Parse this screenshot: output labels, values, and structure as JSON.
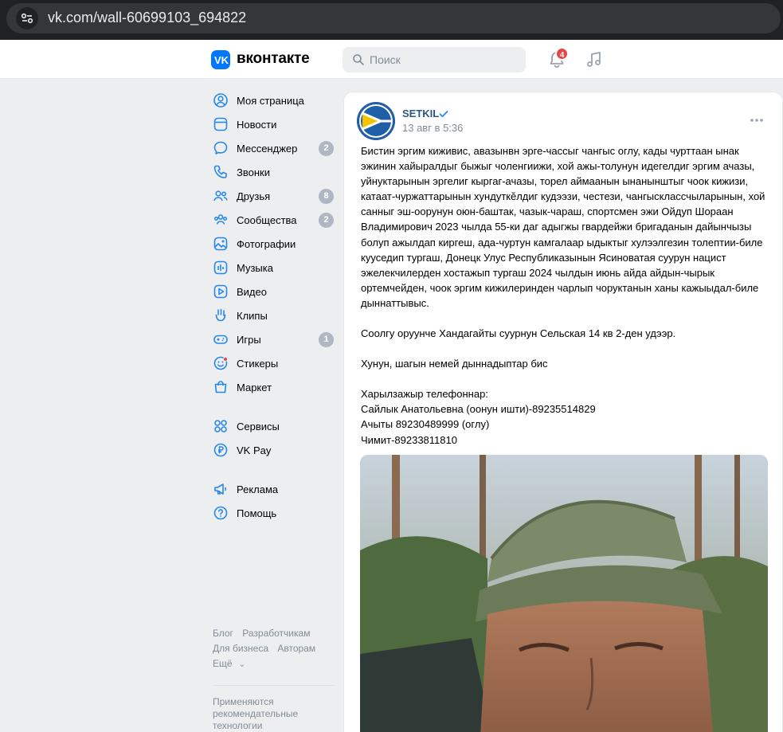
{
  "browser": {
    "url": "vk.com/wall-60699103_694822",
    "icon": "tune-icon"
  },
  "header": {
    "logo_text": "вконтакте",
    "search_placeholder": "Поиск",
    "notifications_count": "4",
    "icons": [
      "vk-logo-icon",
      "search-icon",
      "bell-icon",
      "music-icon"
    ]
  },
  "sidebar": {
    "items": [
      {
        "label": "Моя страница",
        "icon": "user-circle-icon"
      },
      {
        "label": "Новости",
        "icon": "newspaper-icon"
      },
      {
        "label": "Мессенджер",
        "icon": "chat-bubble-icon",
        "count": "2"
      },
      {
        "label": "Звонки",
        "icon": "phone-icon"
      },
      {
        "label": "Друзья",
        "icon": "friends-icon",
        "count": "8"
      },
      {
        "label": "Сообщества",
        "icon": "communities-icon",
        "count": "2"
      },
      {
        "label": "Фотографии",
        "icon": "photo-icon"
      },
      {
        "label": "Музыка",
        "icon": "music-bars-icon"
      },
      {
        "label": "Видео",
        "icon": "video-icon"
      },
      {
        "label": "Клипы",
        "icon": "clips-icon"
      },
      {
        "label": "Игры",
        "icon": "gamepad-icon",
        "count": "1"
      },
      {
        "label": "Стикеры",
        "icon": "smile-icon"
      },
      {
        "label": "Маркет",
        "icon": "shopping-bag-icon"
      }
    ],
    "items2": [
      {
        "label": "Сервисы",
        "icon": "services-grid-icon"
      },
      {
        "label": "VK Pay",
        "icon": "vkpay-icon"
      }
    ],
    "items3": [
      {
        "label": "Реклама",
        "icon": "megaphone-icon"
      },
      {
        "label": "Помощь",
        "icon": "help-icon"
      }
    ]
  },
  "footer": {
    "links_row1": [
      "Блог",
      "Разработчикам"
    ],
    "links_row2": [
      "Для бизнеса",
      "Авторам"
    ],
    "more": "Ещё",
    "note": "Применяются рекомендательные технологии"
  },
  "post": {
    "author": "SETKIL",
    "date": "13 авг в 5:36",
    "paragraphs": [
      "Бистин эргим киживис, авазынвн эрге-чассыг чангыс оглу, кады чурттаан ынак эжинин хайыралдыг быжыг чоленгиижи, хой ажы-толунун идегелдиг эргим ачазы, уйнуктарынын эргелиг кыргаг-ачазы, торел аймаанын ынанынштыг чоок кижизи, катаат-чуржаттарынын хундуткӗлдиг кудээзи, честези, чангыс­классчыларынын, хой санныг эш-оорунун оюн-баштак, чазык-чараш, спортсмен эжи Ойдуп Шораан Владимирович 2023 чылда 55-ки даг адыгжы гвардейжи бригаданын дайынчызы болуп ажылдап киргеш, ада-чуртун камгалаар ыдыктыг хулээлгезин толептии-биле кууседип тургаш, Донецк Улус Республиказынын Ясиноватая суурун нацист эжелекчилерден хостажып тургаш 2024 чылдын июнь айда айдын-чырык ортемчейден, чоок эргим кижилеринден чарлып чоруктанын ханы кажыыдал-биле дыннаттывыс.",
      "Соолгу оруунче Хандагайты суурнун Сельская 14 кв 2-ден удээр.",
      "Хунун, шагын немей дыннадыптар бис",
      "Харылзажыр телефоннар:\nСайлык Анатольевна (оонун ишти)-89235514829\nАчыты 89230489999 (оглу)\nЧимит-89233811810"
    ]
  }
}
